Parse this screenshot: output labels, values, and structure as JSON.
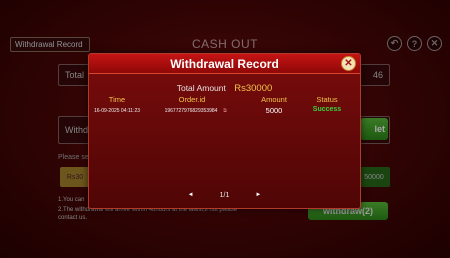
{
  "background": {
    "record_tab_label": "Withdrawal Record",
    "page_title": "CASH OUT",
    "icons": [
      "back-icon",
      "help-icon",
      "close-icon"
    ],
    "total_label": "Total",
    "total_value_partial": "46",
    "withdraw_label": "Withd",
    "withdraw_button_partial": "let",
    "please_label": "Please se",
    "amount_chip": "Rs30",
    "amount_right": "50000",
    "note1": "1.You can",
    "note2": "2.The withdrawal will arrive within 48hours at the latest,if not please contact us.",
    "withdraw_button": "withdraw(2)"
  },
  "modal": {
    "title": "Withdrawal Record",
    "total_amount_label": "Total Amount",
    "total_amount_value": "Rs30000",
    "columns": {
      "time": "Time",
      "order_id": "Order.id",
      "amount": "Amount",
      "status": "Status"
    },
    "rows": [
      {
        "time": "16-09-2025 04:11:23",
        "order_id": "1967727976829353984",
        "amount": "5000",
        "status": "Success"
      }
    ],
    "pager": {
      "prev": "◄",
      "page": "1/1",
      "next": "►"
    }
  },
  "colors": {
    "accent_gold": "#f0c34a",
    "success_green": "#36d43a",
    "header_red": "#c51414"
  }
}
